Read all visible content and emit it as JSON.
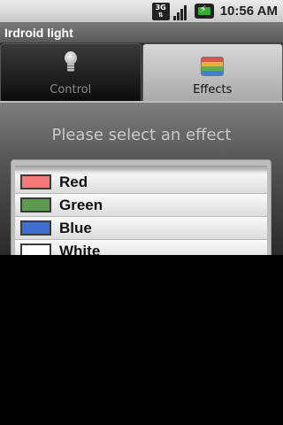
{
  "status_bar": {
    "network_label": "3G",
    "time": "10:56 AM",
    "icons": [
      "network-3g-icon",
      "signal-icon",
      "battery-charging-icon"
    ]
  },
  "app": {
    "title": "Irdroid light"
  },
  "tabs": [
    {
      "label": "Control",
      "icon": "lightbulb-icon",
      "selected": false
    },
    {
      "label": "Effects",
      "icon": "color-stripes-icon",
      "selected": true
    }
  ],
  "main": {
    "prompt": "Please select an effect",
    "effects": [
      {
        "label": "Red",
        "color": "#f47a7a"
      },
      {
        "label": "Green",
        "color": "#5f9a52"
      },
      {
        "label": "Blue",
        "color": "#3f6fcf"
      },
      {
        "label": "White",
        "color": "#ffffff"
      }
    ]
  },
  "colors": {
    "stripe_colors": [
      "#d9534f",
      "#e8b23a",
      "#5fae4f",
      "#3d7fd4"
    ]
  }
}
